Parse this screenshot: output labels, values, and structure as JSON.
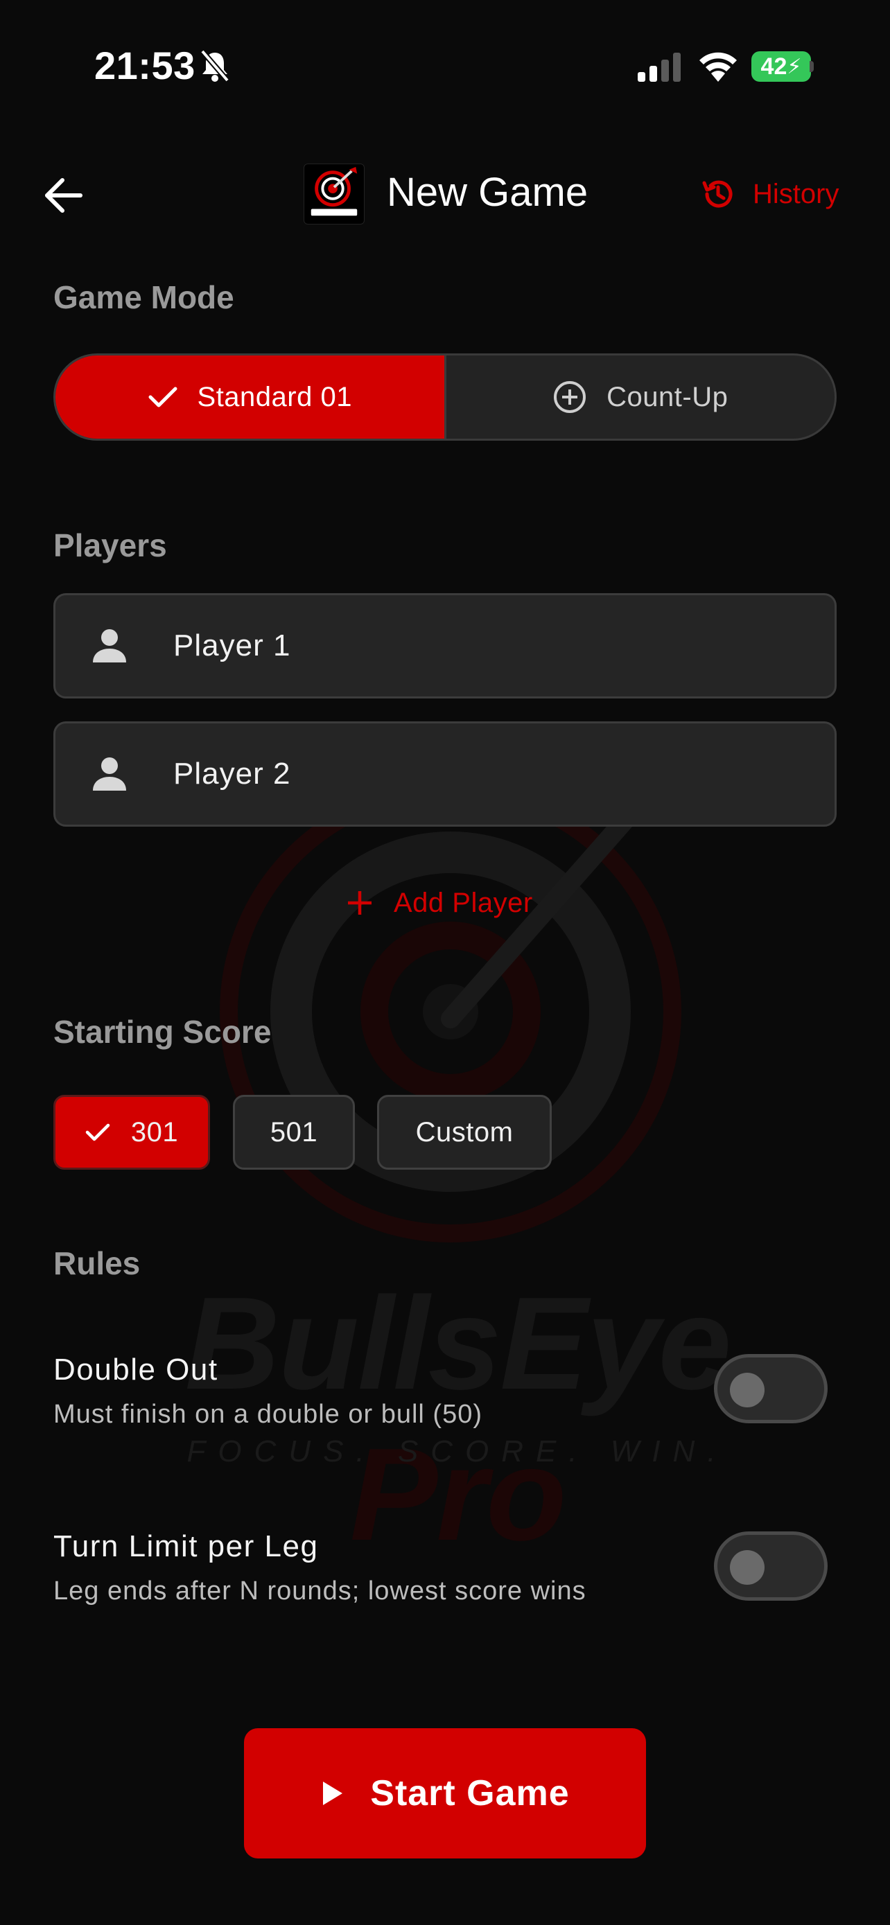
{
  "status_bar": {
    "time": "21:53",
    "battery": "42"
  },
  "header": {
    "title": "New Game",
    "history_label": "History",
    "logo_alt": "BullsEye Pro"
  },
  "game_mode": {
    "label": "Game Mode",
    "options": [
      {
        "label": "Standard 01",
        "selected": true
      },
      {
        "label": "Count-Up",
        "selected": false
      }
    ]
  },
  "players": {
    "label": "Players",
    "list": [
      {
        "name": "Player 1"
      },
      {
        "name": "Player 2"
      }
    ],
    "add_label": "Add Player"
  },
  "starting_score": {
    "label": "Starting Score",
    "options": [
      {
        "label": "301",
        "selected": true
      },
      {
        "label": "501",
        "selected": false
      },
      {
        "label": "Custom",
        "selected": false
      }
    ]
  },
  "rules": {
    "label": "Rules",
    "items": [
      {
        "title": "Double Out",
        "description": "Must finish on a double or bull (50)",
        "enabled": false
      },
      {
        "title": "Turn Limit per Leg",
        "description": "Leg ends after N rounds; lowest score wins",
        "enabled": false
      }
    ]
  },
  "watermark": {
    "brand_main": "BullsEye",
    "brand_accent": "Pro",
    "tagline": "FOCUS. SCORE. WIN."
  },
  "start_button": {
    "label": "Start Game"
  },
  "colors": {
    "accent": "#d20000",
    "background": "#0a0a0a",
    "surface": "#252525",
    "battery": "#34c759"
  }
}
